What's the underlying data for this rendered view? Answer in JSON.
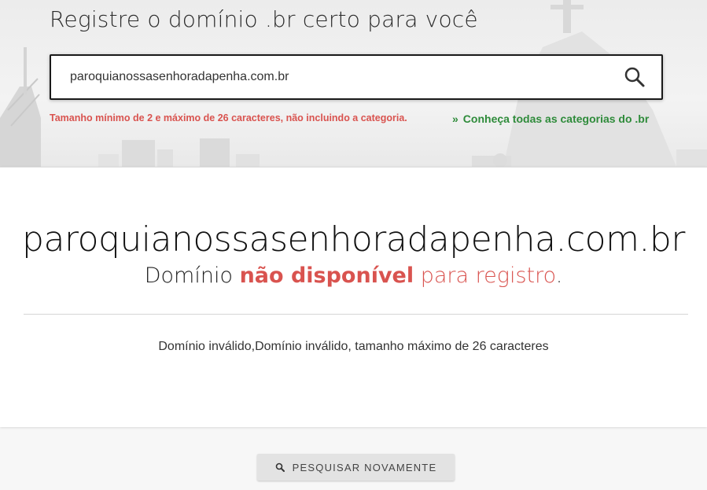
{
  "header": {
    "title": "Registre o domínio .br certo para você",
    "search_value": "paroquianossasenhoradapenha.com.br",
    "search_icon": "search-icon",
    "hint": "Tamanho mínimo de 2 e máximo de 26 caracteres, não incluindo a categoria.",
    "categories_link_prefix": "»",
    "categories_link": "Conheça todas as categorias do .br"
  },
  "result": {
    "domain": "paroquianossasenhoradapenha.com.br",
    "status_prefix": "Domínio",
    "status_strong": "não disponível",
    "status_suffix": "para registro",
    "status_end": ".",
    "message": "Domínio inválido,Domínio inválido, tamanho máximo de 26 caracteres"
  },
  "actions": {
    "search_again_label": "PESQUISAR NOVAMENTE",
    "search_again_icon": "search-icon"
  },
  "colors": {
    "error": "#d9534f",
    "link": "#2e8b3a",
    "button_bg": "#e3e3e3"
  }
}
